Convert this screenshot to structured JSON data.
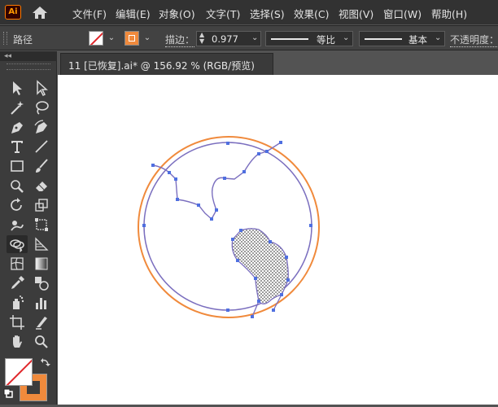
{
  "app": {
    "logo_text": "Ai"
  },
  "menu": {
    "items": [
      "文件(F)",
      "编辑(E)",
      "对象(O)",
      "文字(T)",
      "选择(S)",
      "效果(C)",
      "视图(V)",
      "窗口(W)",
      "帮助(H)"
    ]
  },
  "control_bar": {
    "selection_type": "路径",
    "stroke_label": "描边：",
    "stroke_weight": "0.977",
    "variable_width_profile": "等比",
    "brush_definition": "基本",
    "opacity_label": "不透明度："
  },
  "tools_panel": {
    "collapse_glyph": "◂◂"
  },
  "document": {
    "tab_title": "11 [已恢复].ai* @ 156.92 % (RGB/预览)"
  },
  "colors": {
    "stroke_color": "#f08a3c",
    "path_color": "#7b6fbf",
    "anchor_color": "#4f6fe0",
    "ui_dark": "#323232"
  },
  "icons": [
    "home-icon",
    "selection-tool-icon",
    "direct-selection-tool-icon",
    "magic-wand-icon",
    "lasso-icon",
    "pen-icon",
    "curvature-icon",
    "type-icon",
    "line-segment-icon",
    "rectangle-icon",
    "paintbrush-icon",
    "shaper-icon",
    "eraser-icon",
    "rotate-icon",
    "scale-icon",
    "puppet-warp-icon",
    "free-transform-icon",
    "shape-builder-icon",
    "perspective-grid-icon",
    "mesh-icon",
    "gradient-icon",
    "eyedropper-icon",
    "blend-icon",
    "symbol-sprayer-icon",
    "column-graph-icon",
    "artboard-icon",
    "slice-icon",
    "hand-icon",
    "zoom-icon"
  ]
}
